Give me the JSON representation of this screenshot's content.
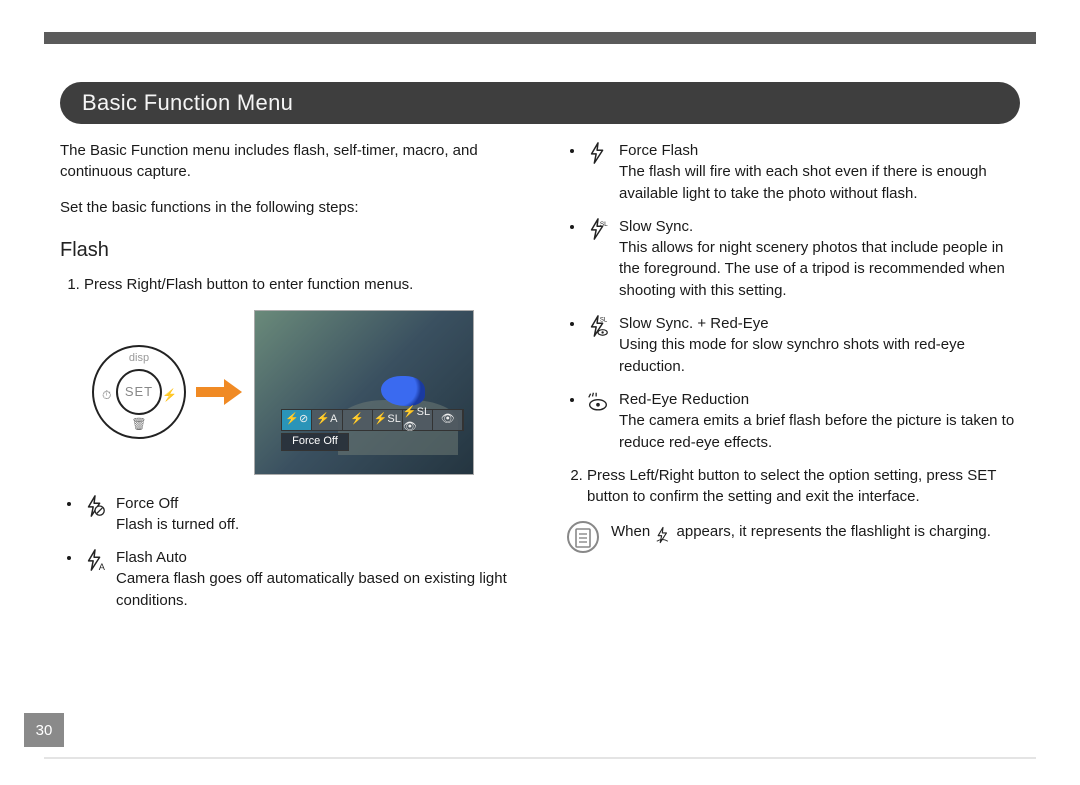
{
  "page_number": "30",
  "title": "Basic Function Menu",
  "left": {
    "intro": "The Basic Function menu includes flash, self-timer, macro, and continuous capture.",
    "intro2": "Set the basic functions in the following steps:",
    "subhead": "Flash",
    "step1": "Press Right/Flash button to enter function menus.",
    "dial": {
      "top": "disp",
      "center": "SET",
      "left": "⏱",
      "right": "⚡",
      "bottom": "🗑"
    },
    "screen_label": "Force Off",
    "items": [
      {
        "icon": "flash-off",
        "title": "Force Off",
        "desc": "Flash is turned off."
      },
      {
        "icon": "flash-auto",
        "title": "Flash Auto",
        "desc": "Camera flash goes off automatically based on existing light conditions."
      }
    ]
  },
  "right": {
    "items": [
      {
        "icon": "flash-force",
        "title": "Force Flash",
        "desc": "The flash will fire with each shot even if there is enough available light to take the photo without flash."
      },
      {
        "icon": "flash-slow",
        "title": "Slow Sync.",
        "desc": "This allows for night scenery photos that include people in the foreground. The use of a tripod is recommended when shooting with this setting."
      },
      {
        "icon": "flash-slow-redeye",
        "title": "Slow Sync. + Red-Eye",
        "desc": "Using this mode for slow synchro shots with red-eye reduction."
      },
      {
        "icon": "flash-redeye",
        "title": "Red-Eye Reduction",
        "desc": "The camera emits a brief flash before the picture is taken to reduce red-eye effects."
      }
    ],
    "step2": "Press Left/Right button to select the option setting, press SET button to confirm the setting and exit the interface.",
    "note_pre": "When ",
    "note_post": " appears, it represents the flashlight is charging."
  }
}
